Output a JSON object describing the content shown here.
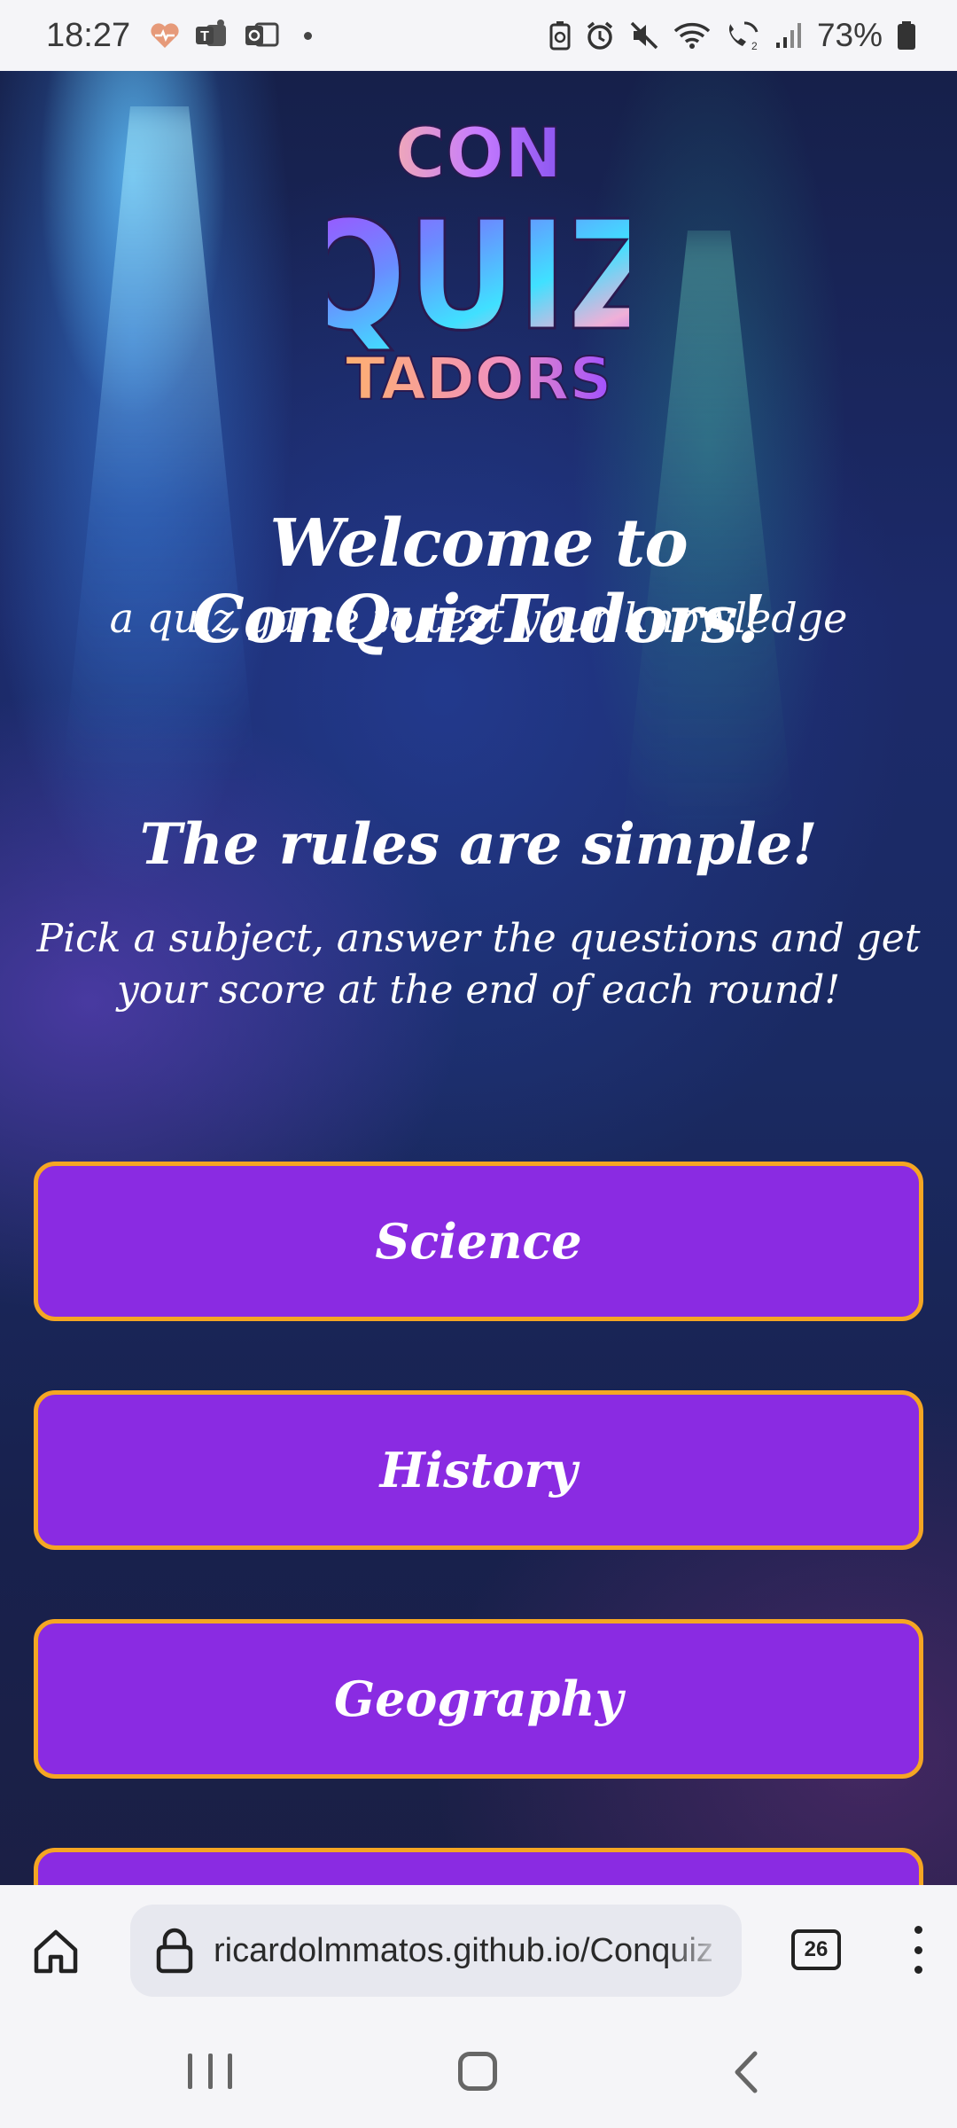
{
  "status_bar": {
    "time": "18:27",
    "battery": "73%",
    "left_icons": [
      "health-heart-icon",
      "teams-icon",
      "outlook-icon",
      "notification-dot-icon"
    ],
    "right_icons": [
      "battery-saver-icon",
      "alarm-icon",
      "mute-icon",
      "wifi-icon",
      "wifi-calling-icon",
      "signal-icon",
      "battery-icon"
    ]
  },
  "logo": {
    "line1": "CON",
    "line2": "QUIZ",
    "line3": "TADORS"
  },
  "welcome": {
    "title": "Welcome to ConQuizTadors!",
    "subtitle": "a quiz game to test your knowledge"
  },
  "rules": {
    "title": "The rules are simple!",
    "text": "Pick a subject, answer the questions and get your score at the end of each round!"
  },
  "subjects": [
    "Science",
    "History",
    "Geography",
    ""
  ],
  "colors": {
    "button_fill": "#8a2be2",
    "button_border": "#f5a623",
    "text": "#ffffff",
    "chrome_bg": "#f5f5f8"
  },
  "browser": {
    "url": "ricardolmmatos.github.io/Conquiz",
    "tab_count": "26"
  }
}
